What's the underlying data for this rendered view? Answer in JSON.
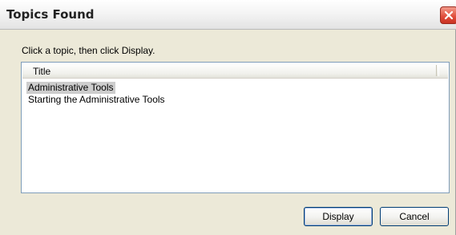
{
  "window": {
    "title": "Topics Found",
    "close_icon": "close-icon"
  },
  "prompt": "Click a topic, then click Display.",
  "list": {
    "column_header": "Title",
    "items": [
      {
        "label": "Administrative Tools",
        "selected": true
      },
      {
        "label": "Starting the Administrative Tools",
        "selected": false
      }
    ]
  },
  "buttons": {
    "display": "Display",
    "cancel": "Cancel"
  },
  "colors": {
    "selection": "#cdcdcd",
    "close_red": "#e04b3a",
    "dialog_bg": "#ece9d8"
  }
}
